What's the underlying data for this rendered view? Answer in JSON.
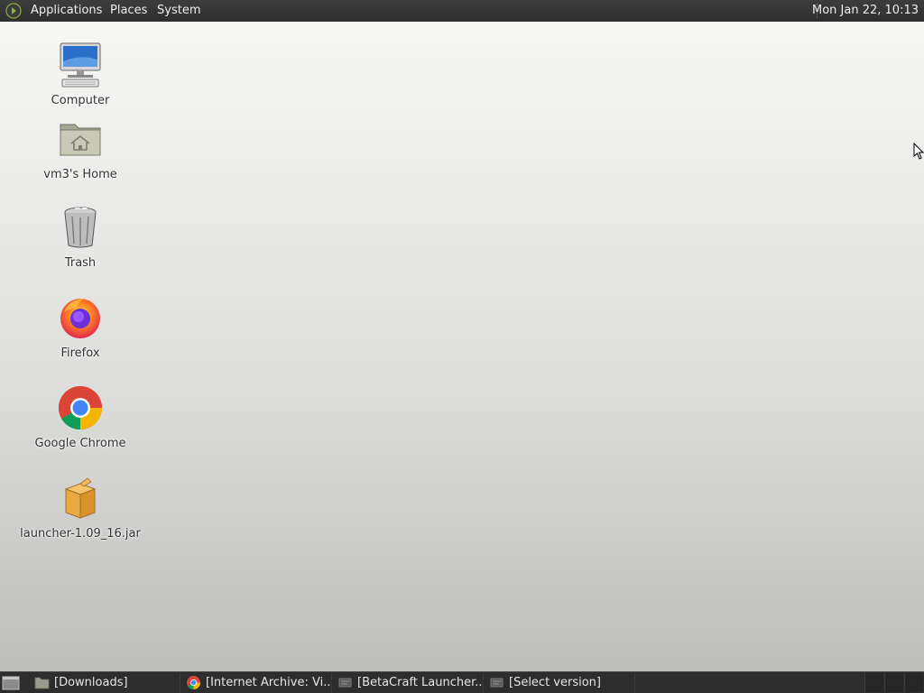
{
  "top_panel": {
    "menus": {
      "applications": "Applications",
      "places": "Places",
      "system": "System"
    },
    "clock": "Mon Jan 22, 10:13"
  },
  "desktop": {
    "icons": [
      {
        "label": "Computer",
        "icon": "computer-icon"
      },
      {
        "label": "vm3's Home",
        "icon": "home-folder-icon"
      },
      {
        "label": "Trash",
        "icon": "trash-icon"
      },
      {
        "label": "Firefox",
        "icon": "firefox-icon"
      },
      {
        "label": "Google Chrome",
        "icon": "chrome-icon"
      },
      {
        "label": "launcher-1.09_16.jar",
        "icon": "jar-package-icon"
      }
    ]
  },
  "taskbar": {
    "tasks": [
      {
        "label": "[Downloads]",
        "icon": "folder-icon"
      },
      {
        "label": "[Internet Archive: Vi...",
        "icon": "chrome-icon"
      },
      {
        "label": "[BetaCraft Launcher...",
        "icon": "java-icon"
      },
      {
        "label": "[Select version]",
        "icon": "java-icon"
      }
    ],
    "workspaces": 3
  },
  "colors": {
    "panel_bg": "#2e2e2e",
    "panel_text": "#eeeeee",
    "desktop_top": "#f7f7f5",
    "desktop_bottom": "#bdbdbb",
    "icon_label": "#333333"
  }
}
